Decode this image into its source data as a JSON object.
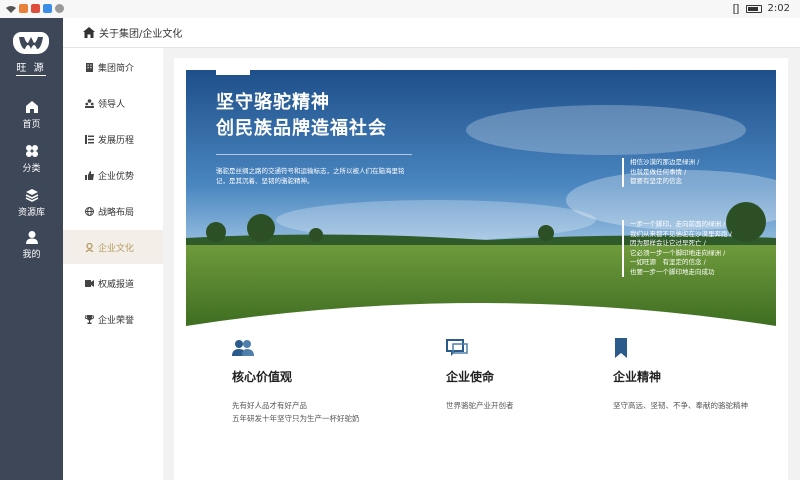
{
  "status_bar": {
    "time": "2:02"
  },
  "left_nav": {
    "logo_text": "旺 源",
    "items": [
      {
        "label": "首页",
        "icon": "home-icon"
      },
      {
        "label": "分类",
        "icon": "category-icon"
      },
      {
        "label": "资源库",
        "icon": "resource-icon"
      },
      {
        "label": "我的",
        "icon": "user-icon"
      }
    ]
  },
  "breadcrumb": {
    "text": "关于集团/企业文化"
  },
  "sub_menu": {
    "items": [
      {
        "label": "集团简介",
        "icon": "building-icon"
      },
      {
        "label": "领导人",
        "icon": "people-icon"
      },
      {
        "label": "发展历程",
        "icon": "timeline-icon"
      },
      {
        "label": "企业优势",
        "icon": "thumbs-up-icon"
      },
      {
        "label": "战略布局",
        "icon": "globe-icon"
      },
      {
        "label": "企业文化",
        "icon": "culture-icon"
      },
      {
        "label": "权威报道",
        "icon": "report-icon"
      },
      {
        "label": "企业荣誉",
        "icon": "trophy-icon"
      }
    ],
    "active_index": 5
  },
  "hero": {
    "title_line1": "坚守骆驼精神",
    "title_line2": "创民族品牌造福社会",
    "description": "骆驼是丝绸之路的交通符号和运输标志，之所以被人们在脑海里铭记，是其沉着、坚韧的骆驼精神。",
    "quote1": [
      "相信沙漠的那边是绿洲 /",
      "也就是做任何事情 /",
      "都要有坚定的信念"
    ],
    "quote2": [
      "一步一个脚印，走向前面的绿洲 /",
      "我们从来都不见骆驼在沙漠里奔跑 /",
      "因为那样会让它过早死亡 /",
      "它必须一步一个脚印地走向绿洲 /",
      "一如旺源　有坚定的信念 /",
      "也要一步一个脚印地走向成功"
    ]
  },
  "values": [
    {
      "title": "核心价值观",
      "lines": [
        "先有好人品才有好产品",
        "五年研发十年坚守只为生产一杯好驼奶"
      ],
      "icon": "team-icon"
    },
    {
      "title": "企业使命",
      "lines": [
        "世界骆驼产业开创者"
      ],
      "icon": "chat-icon"
    },
    {
      "title": "企业精神",
      "lines": [
        "坚守高远、坚韧、不争、奉献的骆驼精神"
      ],
      "icon": "bookmark-icon"
    }
  ],
  "colors": {
    "nav_bg": "#3d4757",
    "accent": "#b99b62",
    "icon_blue": "#2b5b8a"
  }
}
